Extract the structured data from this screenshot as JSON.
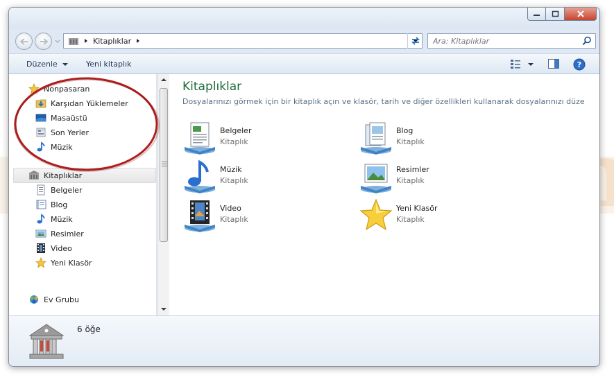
{
  "watermark": "nonpasaran",
  "address": {
    "crumb": "Kitaplıklar"
  },
  "search": {
    "placeholder": "Ara: Kitaplıklar"
  },
  "toolbar": {
    "organize": "Düzenle",
    "new_library": "Yeni kitaplık"
  },
  "nav": {
    "favorites": {
      "label": "Nonpasaran",
      "items": [
        "Karşıdan Yüklemeler",
        "Masaüstü",
        "Son Yerler",
        "Müzik"
      ]
    },
    "libraries": {
      "label": "Kitaplıklar",
      "items": [
        "Belgeler",
        "Blog",
        "Müzik",
        "Resimler",
        "Video",
        "Yeni Klasör"
      ]
    },
    "homegroup": "Ev Grubu"
  },
  "content": {
    "title": "Kitaplıklar",
    "description": "Dosyalarınızı görmek için bir kitaplık açın ve klasör, tarih ve diğer özellikleri kullanarak dosyalarınızı düzenl...",
    "libraries": [
      {
        "name": "Belgeler",
        "type": "Kitaplık",
        "icon": "documents-library-icon"
      },
      {
        "name": "Blog",
        "type": "Kitaplık",
        "icon": "blog-library-icon"
      },
      {
        "name": "Müzik",
        "type": "Kitaplık",
        "icon": "music-library-icon"
      },
      {
        "name": "Resimler",
        "type": "Kitaplık",
        "icon": "pictures-library-icon"
      },
      {
        "name": "Video",
        "type": "Kitaplık",
        "icon": "video-library-icon"
      },
      {
        "name": "Yeni Klasör",
        "type": "Kitaplık",
        "icon": "star-library-icon"
      }
    ]
  },
  "details": {
    "count": "6 öğe"
  },
  "colors": {
    "title_green": "#1e6b38",
    "annotation_red": "#b01e1e",
    "toolbar_text": "#1e395b"
  }
}
